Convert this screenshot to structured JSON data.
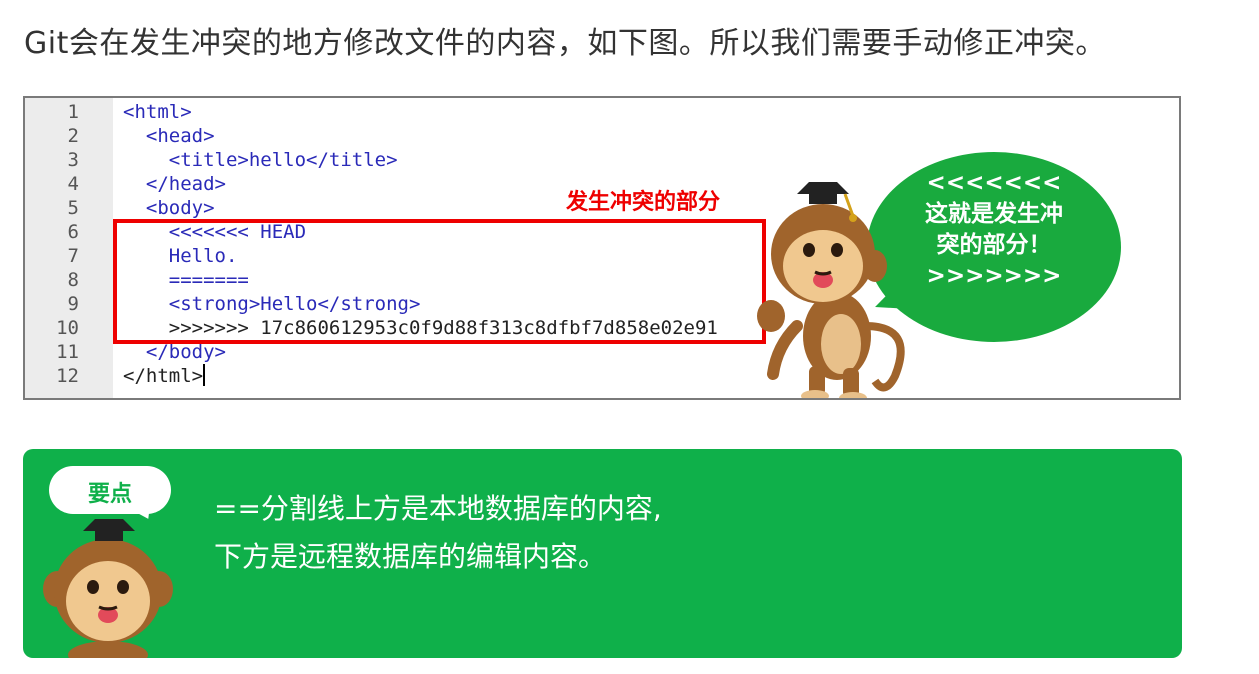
{
  "intro": "Git会在发生冲突的地方修改文件的内容，如下图。所以我们需要手动修正冲突。",
  "code": {
    "line_numbers": [
      "1",
      "2",
      "3",
      "4",
      "5",
      "6",
      "7",
      "8",
      "9",
      "10",
      "11",
      "12"
    ],
    "lines": [
      "<html>",
      "  <head>",
      "    <title>hello</title>",
      "  </head>",
      "  <body>",
      "    <<<<<<< HEAD",
      "    Hello.",
      "    =======",
      "    <strong>Hello</strong>",
      "    >>>>>>> 17c860612953c0f9d88f313c8dfbf7d858e02e91",
      "  </body>",
      "</html>"
    ]
  },
  "conflict_label": "发生冲突的部分",
  "bubble": {
    "line1": "<<<<<<<",
    "line2": "这就是发生冲",
    "line3": "突的部分！",
    "line4": ">>>>>>>"
  },
  "tip": {
    "badge": "要点",
    "line1": "==分割线上方是本地数据库的内容,",
    "line2": "下方是远程数据库的编辑内容。"
  },
  "colors": {
    "accent_green": "#0fb04a",
    "conflict_red": "#ee0000",
    "code_blue": "#2a2ab8"
  }
}
